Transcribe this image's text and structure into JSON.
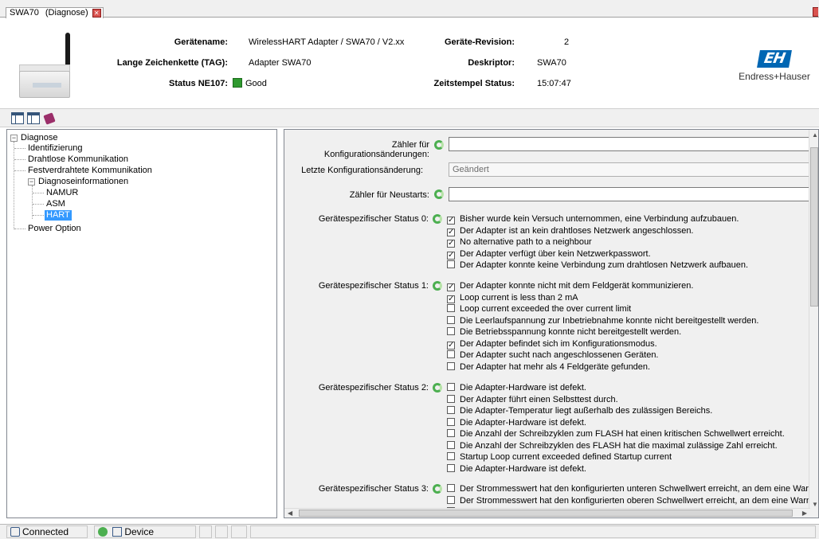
{
  "tab": {
    "title": "SWA70",
    "subtitle": "(Diagnose)"
  },
  "header": {
    "device_name_label": "Gerätename:",
    "device_name_value": "WirelessHART Adapter / SWA70 / V2.xx",
    "tag_label": "Lange Zeichenkette (TAG):",
    "tag_value": "Adapter SWA70",
    "status_label": "Status NE107:",
    "status_value": "Good",
    "status_color": "#2f9a2f",
    "revision_label": "Geräte-Revision:",
    "revision_value": "2",
    "descriptor_label": "Deskriptor:",
    "descriptor_value": "SWA70",
    "timestamp_label": "Zeitstempel Status:",
    "timestamp_value": "15:07:47",
    "logo_mark": "EH",
    "logo_text": "Endress+Hauser",
    "brand_color": "#0066b3"
  },
  "tree": {
    "root": "Diagnose",
    "items": [
      "Identifizierung",
      "Drahtlose Kommunikation",
      "Festverdrahtete Kommunikation",
      "Diagnoseinformationen"
    ],
    "sub": [
      "NAMUR",
      "ASM",
      "HART"
    ],
    "last": "Power Option"
  },
  "form": {
    "config_counter_label": "Zähler für Konfigurationsänderungen:",
    "config_counter_value": "",
    "last_change_label": "Letzte Konfigurationsänderung:",
    "last_change_value": "Geändert",
    "restart_counter_label": "Zähler für Neustarts:",
    "restart_counter_value": ""
  },
  "status0": {
    "label": "Gerätespezifischer Status 0:",
    "items": [
      {
        "text": "Bisher wurde kein Versuch unternommen, eine Verbindung aufzubauen.",
        "checked": true
      },
      {
        "text": "Der Adapter ist an kein drahtloses Netzwerk angeschlossen.",
        "checked": true
      },
      {
        "text": "No alternative path to a neighbour",
        "checked": true
      },
      {
        "text": "Der Adapter verfügt über kein Netzwerkpasswort.",
        "checked": true
      },
      {
        "text": "Der Adapter konnte keine Verbindung zum drahtlosen Netzwerk aufbauen.",
        "checked": false
      }
    ]
  },
  "status1": {
    "label": "Gerätespezifischer Status 1:",
    "items": [
      {
        "text": "Der Adapter konnte nicht mit dem Feldgerät kommunizieren.",
        "checked": true
      },
      {
        "text": "Loop current is less than 2 mA",
        "checked": true
      },
      {
        "text": "Loop current exceeded the over current limit",
        "checked": false
      },
      {
        "text": "Die Leerlaufspannung zur Inbetriebnahme konnte nicht bereitgestellt werden.",
        "checked": false
      },
      {
        "text": "Die Betriebsspannung konnte nicht bereitgestellt werden.",
        "checked": false
      },
      {
        "text": "Der Adapter befindet sich im Konfigurationsmodus.",
        "checked": true
      },
      {
        "text": "Der Adapter sucht nach angeschlossenen Geräten.",
        "checked": false
      },
      {
        "text": "Der Adapter hat mehr als 4 Feldgeräte gefunden.",
        "checked": false
      }
    ]
  },
  "status2": {
    "label": "Gerätespezifischer Status 2:",
    "items": [
      {
        "text": "Die Adapter-Hardware ist defekt.",
        "checked": false
      },
      {
        "text": "Der Adapter führt einen Selbsttest durch.",
        "checked": false
      },
      {
        "text": "Die Adapter-Temperatur liegt außerhalb des zulässigen Bereichs.",
        "checked": false
      },
      {
        "text": "Die Adapter-Hardware ist defekt.",
        "checked": false
      },
      {
        "text": "Die Anzahl der Schreibzyklen zum FLASH hat einen kritischen Schwellwert erreicht.",
        "checked": false
      },
      {
        "text": "Die Anzahl der Schreibzyklen des FLASH hat die maximal zulässige Zahl erreicht.",
        "checked": false
      },
      {
        "text": "Startup Loop current exceeded defined Startup current",
        "checked": false
      },
      {
        "text": "Die Adapter-Hardware ist defekt.",
        "checked": false
      }
    ]
  },
  "status3": {
    "label": "Gerätespezifischer Status 3:",
    "items": [
      {
        "text": "Der Strommesswert hat den konfigurierten unteren Schwellwert erreicht, an dem eine Warnung ausge",
        "checked": false
      },
      {
        "text": "Der Strommesswert hat den konfigurierten oberen Schwellwert erreicht, an dem eine Warnung ausge",
        "checked": false
      },
      {
        "text": "Der Strommesswert hat den konfigurierten unteren Schwellwert erreicht, an dem ein Fehler ausgegeb",
        "checked": false
      }
    ]
  },
  "statusbar": {
    "connected": "Connected",
    "device": "Device"
  }
}
